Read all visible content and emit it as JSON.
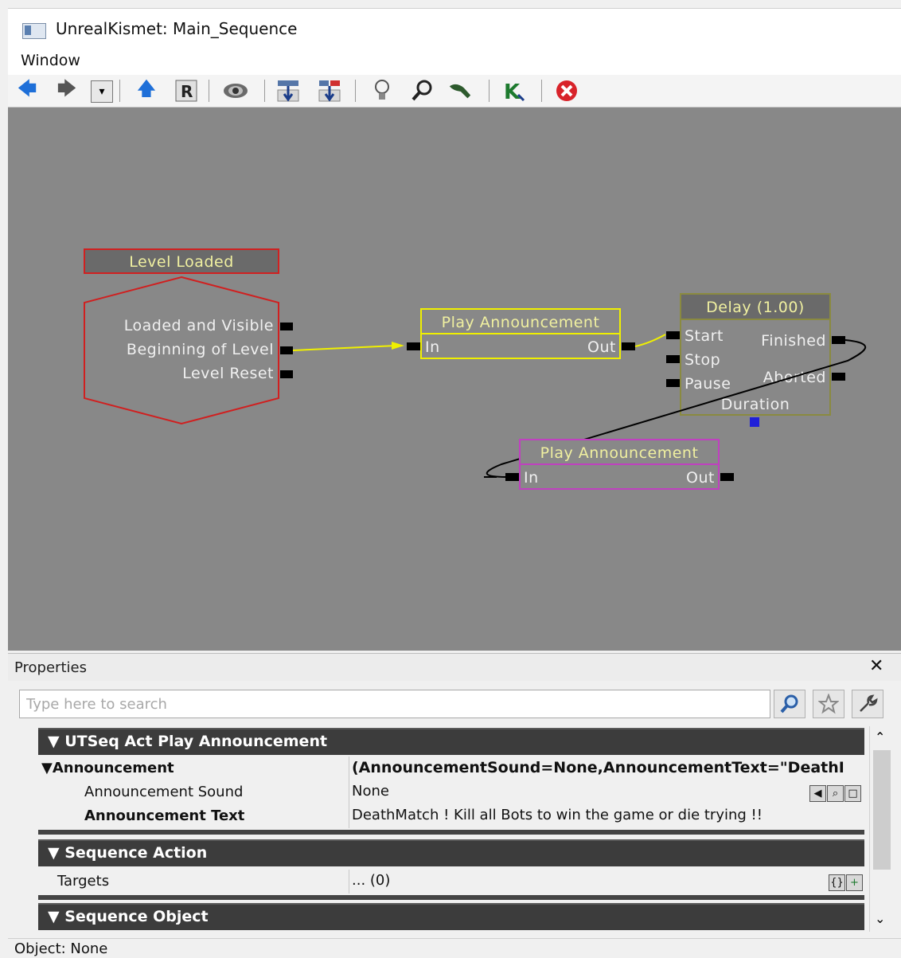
{
  "window": {
    "title": "UnrealKismet: Main_Sequence"
  },
  "menu": {
    "items": [
      "Window"
    ]
  },
  "toolbar": {
    "dropdown_glyph": "▾"
  },
  "canvas": {
    "event_node": {
      "title": "Level Loaded",
      "outputs": [
        "Loaded and Visible",
        "Beginning of Level",
        "Level Reset"
      ]
    },
    "play_announcement_1": {
      "title": "Play Announcement",
      "input": "In",
      "output": "Out"
    },
    "delay_node": {
      "title": "Delay (1.00)",
      "inputs": [
        "Start",
        "Stop",
        "Pause"
      ],
      "outputs": [
        "Finished",
        "Aborted"
      ],
      "variable": "Duration"
    },
    "play_announcement_2": {
      "title": "Play Announcement",
      "input": "In",
      "output": "Out"
    }
  },
  "properties": {
    "title": "Properties",
    "close_glyph": "✕",
    "search_placeholder": "Type here to search",
    "categories": [
      {
        "label": "UTSeq Act Play Announcement",
        "rows": [
          {
            "name": "Announcement",
            "value": "(AnnouncementSound=None,AnnouncementText=\"DeathI"
          },
          {
            "name": "Announcement Sound",
            "value": "None"
          },
          {
            "name": "Announcement Text",
            "value": "DeathMatch ! Kill all Bots to win the game or die trying !!"
          }
        ]
      },
      {
        "label": "Sequence Action",
        "rows": [
          {
            "name": "Targets",
            "value": "... (0)"
          }
        ]
      },
      {
        "label": "Sequence Object",
        "rows": []
      }
    ]
  },
  "status": {
    "text": "Object: None"
  },
  "colors": {
    "canvas_bg": "#888888",
    "event_red": "#d02020",
    "action_yellow": "#f0f000",
    "latent_olive": "#8a8a40",
    "action_magenta": "#c040c0",
    "kismet_text": "#f0f0a0",
    "category_bg": "#3c3c3c"
  }
}
